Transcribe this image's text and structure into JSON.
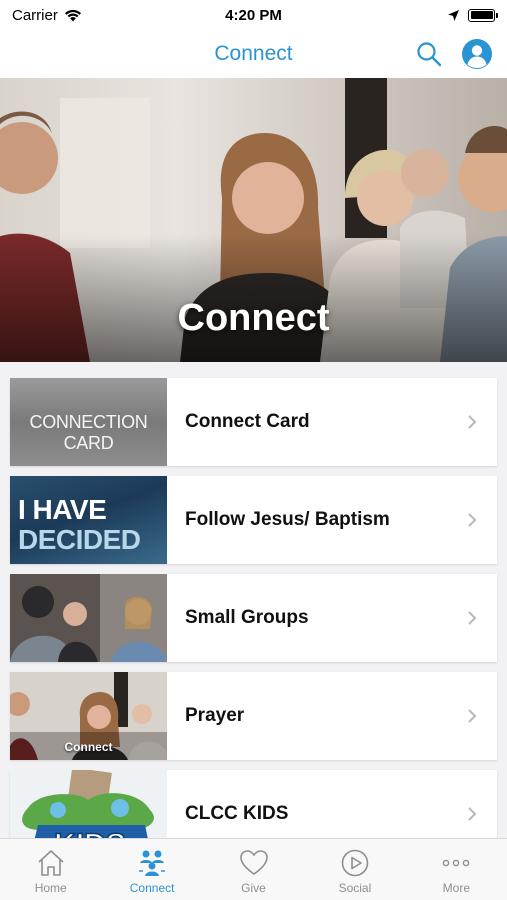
{
  "status_bar": {
    "carrier": "Carrier",
    "time": "4:20 PM"
  },
  "nav": {
    "title": "Connect",
    "accent_color": "#2a93d4",
    "icons": [
      "search-icon",
      "profile-icon"
    ]
  },
  "hero": {
    "title": "Connect"
  },
  "items": [
    {
      "label": "Connect Card",
      "thumb_text": "CONNECTION CARD",
      "icon": "chevron-right-icon"
    },
    {
      "label": "Follow Jesus/ Baptism",
      "thumb_line1": "I HAVE",
      "thumb_line2": "DECIDED",
      "icon": "chevron-right-icon"
    },
    {
      "label": "Small Groups",
      "icon": "chevron-right-icon"
    },
    {
      "label": "Prayer",
      "thumb_text": "Connect",
      "icon": "chevron-right-icon"
    },
    {
      "label": "CLCC KIDS",
      "thumb_text": "KIDS",
      "icon": "chevron-right-icon"
    }
  ],
  "tabs": [
    {
      "label": "Home",
      "icon": "home-icon",
      "active": false
    },
    {
      "label": "Connect",
      "icon": "people-icon",
      "active": true
    },
    {
      "label": "Give",
      "icon": "heart-icon",
      "active": false
    },
    {
      "label": "Social",
      "icon": "play-icon",
      "active": false
    },
    {
      "label": "More",
      "icon": "more-icon",
      "active": false
    }
  ]
}
